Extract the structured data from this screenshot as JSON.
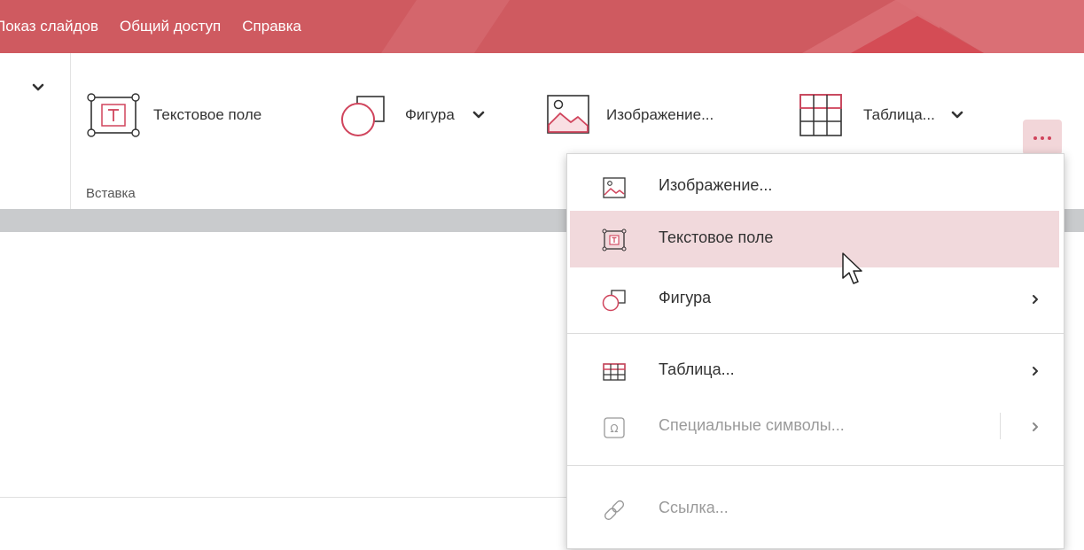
{
  "menubar": {
    "items": [
      "Показ слайдов",
      "Общий доступ",
      "Справка"
    ]
  },
  "ribbon": {
    "buttons": {
      "textbox": "Текстовое поле",
      "shape": "Фигура",
      "image": "Изображение...",
      "table": "Таблица..."
    },
    "group_label": "Вставка"
  },
  "dropdown": {
    "items": [
      {
        "label": "Изображение...",
        "icon": "image-icon",
        "enabled": true,
        "submenu": false
      },
      {
        "label": "Текстовое поле",
        "icon": "textbox-icon",
        "enabled": true,
        "submenu": false,
        "highlighted": true
      },
      {
        "label": "Фигура",
        "icon": "shape-icon",
        "enabled": true,
        "submenu": true
      },
      {
        "label": "Таблица...",
        "icon": "table-icon",
        "enabled": true,
        "submenu": true
      },
      {
        "label": "Специальные символы...",
        "icon": "omega-icon",
        "enabled": false,
        "submenu": true
      },
      {
        "label": "Ссылка...",
        "icon": "link-icon",
        "enabled": false,
        "submenu": false
      }
    ]
  },
  "colors": {
    "accent": "#cf5a60",
    "icon_red": "#d0445c",
    "highlight": "#f1d9dc",
    "strip": "#c9cbcd"
  }
}
